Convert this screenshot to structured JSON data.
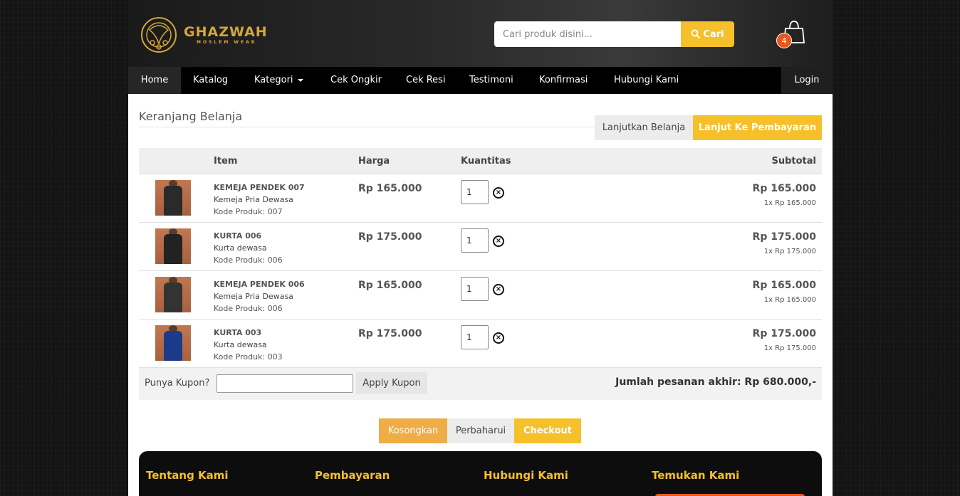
{
  "brand": {
    "name": "GHAZWAH",
    "tagline": "MOSLEM WEAR",
    "accent_color": "#f5c02a"
  },
  "search": {
    "placeholder": "Cari produk disini...",
    "button_label": "Cari",
    "icon": "search-icon"
  },
  "cart": {
    "icon": "shopping-bag-icon",
    "count": "4"
  },
  "nav": {
    "items": [
      {
        "label": "Home",
        "active": true
      },
      {
        "label": "Katalog"
      },
      {
        "label": "Kategori",
        "dropdown": true
      },
      {
        "label": "Cek Ongkir"
      },
      {
        "label": "Cek Resi"
      },
      {
        "label": "Testimoni"
      },
      {
        "label": "Konfirmasi"
      },
      {
        "label": "Hubungi Kami"
      }
    ],
    "login_label": "Login"
  },
  "page": {
    "title": "Keranjang Belanja",
    "continue_label": "Lanjutkan Belanja",
    "pay_label": "Lanjut Ke Pembayaran"
  },
  "table": {
    "headers": {
      "item": "Item",
      "price": "Harga",
      "qty": "Kuantitas",
      "subtotal": "Subtotal"
    },
    "rows": [
      {
        "name": "KEMEJA PENDEK 007",
        "category": "Kemeja Pria Dewasa",
        "code": "Kode Produk: 007",
        "price": "Rp 165.000",
        "qty": "1",
        "subtotal": "Rp 165.000",
        "note": "1x Rp 165.000",
        "shirt_color": "#2a2a2a"
      },
      {
        "name": "KURTA 006",
        "category": "Kurta dewasa",
        "code": "Kode Produk: 006",
        "price": "Rp 175.000",
        "qty": "1",
        "subtotal": "Rp 175.000",
        "note": "1x Rp 175.000",
        "shirt_color": "#222222"
      },
      {
        "name": "KEMEJA PENDEK 006",
        "category": "Kemeja Pria Dewasa",
        "code": "Kode Produk: 006",
        "price": "Rp 165.000",
        "qty": "1",
        "subtotal": "Rp 165.000",
        "note": "1x Rp 165.000",
        "shirt_color": "#333333"
      },
      {
        "name": "KURTA 003",
        "category": "Kurta dewasa",
        "code": "Kode Produk: 003",
        "price": "Rp 175.000",
        "qty": "1",
        "subtotal": "Rp 175.000",
        "note": "1x Rp 175.000",
        "shirt_color": "#1c3a8a"
      }
    ]
  },
  "coupon": {
    "label": "Punya Kupon?",
    "value": "",
    "button_label": "Apply Kupon"
  },
  "total_label": "Jumlah pesanan akhir: Rp 680.000,-",
  "actions": {
    "empty_label": "Kosongkan",
    "update_label": "Perbaharui",
    "checkout_label": "Checkout"
  },
  "footer": {
    "headings": [
      "Tentang Kami",
      "Pembayaran",
      "Hubungi Kami",
      "Temukan Kami"
    ]
  }
}
